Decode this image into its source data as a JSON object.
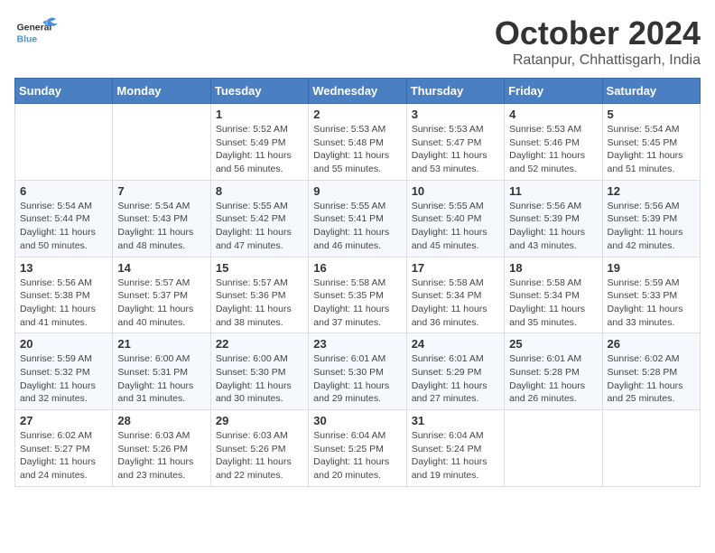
{
  "header": {
    "logo_general": "General",
    "logo_blue": "Blue",
    "month_title": "October 2024",
    "location": "Ratanpur, Chhattisgarh, India"
  },
  "weekdays": [
    "Sunday",
    "Monday",
    "Tuesday",
    "Wednesday",
    "Thursday",
    "Friday",
    "Saturday"
  ],
  "weeks": [
    [
      {
        "day": "",
        "sunrise": "",
        "sunset": "",
        "daylight": ""
      },
      {
        "day": "",
        "sunrise": "",
        "sunset": "",
        "daylight": ""
      },
      {
        "day": "1",
        "sunrise": "Sunrise: 5:52 AM",
        "sunset": "Sunset: 5:49 PM",
        "daylight": "Daylight: 11 hours and 56 minutes."
      },
      {
        "day": "2",
        "sunrise": "Sunrise: 5:53 AM",
        "sunset": "Sunset: 5:48 PM",
        "daylight": "Daylight: 11 hours and 55 minutes."
      },
      {
        "day": "3",
        "sunrise": "Sunrise: 5:53 AM",
        "sunset": "Sunset: 5:47 PM",
        "daylight": "Daylight: 11 hours and 53 minutes."
      },
      {
        "day": "4",
        "sunrise": "Sunrise: 5:53 AM",
        "sunset": "Sunset: 5:46 PM",
        "daylight": "Daylight: 11 hours and 52 minutes."
      },
      {
        "day": "5",
        "sunrise": "Sunrise: 5:54 AM",
        "sunset": "Sunset: 5:45 PM",
        "daylight": "Daylight: 11 hours and 51 minutes."
      }
    ],
    [
      {
        "day": "6",
        "sunrise": "Sunrise: 5:54 AM",
        "sunset": "Sunset: 5:44 PM",
        "daylight": "Daylight: 11 hours and 50 minutes."
      },
      {
        "day": "7",
        "sunrise": "Sunrise: 5:54 AM",
        "sunset": "Sunset: 5:43 PM",
        "daylight": "Daylight: 11 hours and 48 minutes."
      },
      {
        "day": "8",
        "sunrise": "Sunrise: 5:55 AM",
        "sunset": "Sunset: 5:42 PM",
        "daylight": "Daylight: 11 hours and 47 minutes."
      },
      {
        "day": "9",
        "sunrise": "Sunrise: 5:55 AM",
        "sunset": "Sunset: 5:41 PM",
        "daylight": "Daylight: 11 hours and 46 minutes."
      },
      {
        "day": "10",
        "sunrise": "Sunrise: 5:55 AM",
        "sunset": "Sunset: 5:40 PM",
        "daylight": "Daylight: 11 hours and 45 minutes."
      },
      {
        "day": "11",
        "sunrise": "Sunrise: 5:56 AM",
        "sunset": "Sunset: 5:39 PM",
        "daylight": "Daylight: 11 hours and 43 minutes."
      },
      {
        "day": "12",
        "sunrise": "Sunrise: 5:56 AM",
        "sunset": "Sunset: 5:39 PM",
        "daylight": "Daylight: 11 hours and 42 minutes."
      }
    ],
    [
      {
        "day": "13",
        "sunrise": "Sunrise: 5:56 AM",
        "sunset": "Sunset: 5:38 PM",
        "daylight": "Daylight: 11 hours and 41 minutes."
      },
      {
        "day": "14",
        "sunrise": "Sunrise: 5:57 AM",
        "sunset": "Sunset: 5:37 PM",
        "daylight": "Daylight: 11 hours and 40 minutes."
      },
      {
        "day": "15",
        "sunrise": "Sunrise: 5:57 AM",
        "sunset": "Sunset: 5:36 PM",
        "daylight": "Daylight: 11 hours and 38 minutes."
      },
      {
        "day": "16",
        "sunrise": "Sunrise: 5:58 AM",
        "sunset": "Sunset: 5:35 PM",
        "daylight": "Daylight: 11 hours and 37 minutes."
      },
      {
        "day": "17",
        "sunrise": "Sunrise: 5:58 AM",
        "sunset": "Sunset: 5:34 PM",
        "daylight": "Daylight: 11 hours and 36 minutes."
      },
      {
        "day": "18",
        "sunrise": "Sunrise: 5:58 AM",
        "sunset": "Sunset: 5:34 PM",
        "daylight": "Daylight: 11 hours and 35 minutes."
      },
      {
        "day": "19",
        "sunrise": "Sunrise: 5:59 AM",
        "sunset": "Sunset: 5:33 PM",
        "daylight": "Daylight: 11 hours and 33 minutes."
      }
    ],
    [
      {
        "day": "20",
        "sunrise": "Sunrise: 5:59 AM",
        "sunset": "Sunset: 5:32 PM",
        "daylight": "Daylight: 11 hours and 32 minutes."
      },
      {
        "day": "21",
        "sunrise": "Sunrise: 6:00 AM",
        "sunset": "Sunset: 5:31 PM",
        "daylight": "Daylight: 11 hours and 31 minutes."
      },
      {
        "day": "22",
        "sunrise": "Sunrise: 6:00 AM",
        "sunset": "Sunset: 5:30 PM",
        "daylight": "Daylight: 11 hours and 30 minutes."
      },
      {
        "day": "23",
        "sunrise": "Sunrise: 6:01 AM",
        "sunset": "Sunset: 5:30 PM",
        "daylight": "Daylight: 11 hours and 29 minutes."
      },
      {
        "day": "24",
        "sunrise": "Sunrise: 6:01 AM",
        "sunset": "Sunset: 5:29 PM",
        "daylight": "Daylight: 11 hours and 27 minutes."
      },
      {
        "day": "25",
        "sunrise": "Sunrise: 6:01 AM",
        "sunset": "Sunset: 5:28 PM",
        "daylight": "Daylight: 11 hours and 26 minutes."
      },
      {
        "day": "26",
        "sunrise": "Sunrise: 6:02 AM",
        "sunset": "Sunset: 5:28 PM",
        "daylight": "Daylight: 11 hours and 25 minutes."
      }
    ],
    [
      {
        "day": "27",
        "sunrise": "Sunrise: 6:02 AM",
        "sunset": "Sunset: 5:27 PM",
        "daylight": "Daylight: 11 hours and 24 minutes."
      },
      {
        "day": "28",
        "sunrise": "Sunrise: 6:03 AM",
        "sunset": "Sunset: 5:26 PM",
        "daylight": "Daylight: 11 hours and 23 minutes."
      },
      {
        "day": "29",
        "sunrise": "Sunrise: 6:03 AM",
        "sunset": "Sunset: 5:26 PM",
        "daylight": "Daylight: 11 hours and 22 minutes."
      },
      {
        "day": "30",
        "sunrise": "Sunrise: 6:04 AM",
        "sunset": "Sunset: 5:25 PM",
        "daylight": "Daylight: 11 hours and 20 minutes."
      },
      {
        "day": "31",
        "sunrise": "Sunrise: 6:04 AM",
        "sunset": "Sunset: 5:24 PM",
        "daylight": "Daylight: 11 hours and 19 minutes."
      },
      {
        "day": "",
        "sunrise": "",
        "sunset": "",
        "daylight": ""
      },
      {
        "day": "",
        "sunrise": "",
        "sunset": "",
        "daylight": ""
      }
    ]
  ]
}
